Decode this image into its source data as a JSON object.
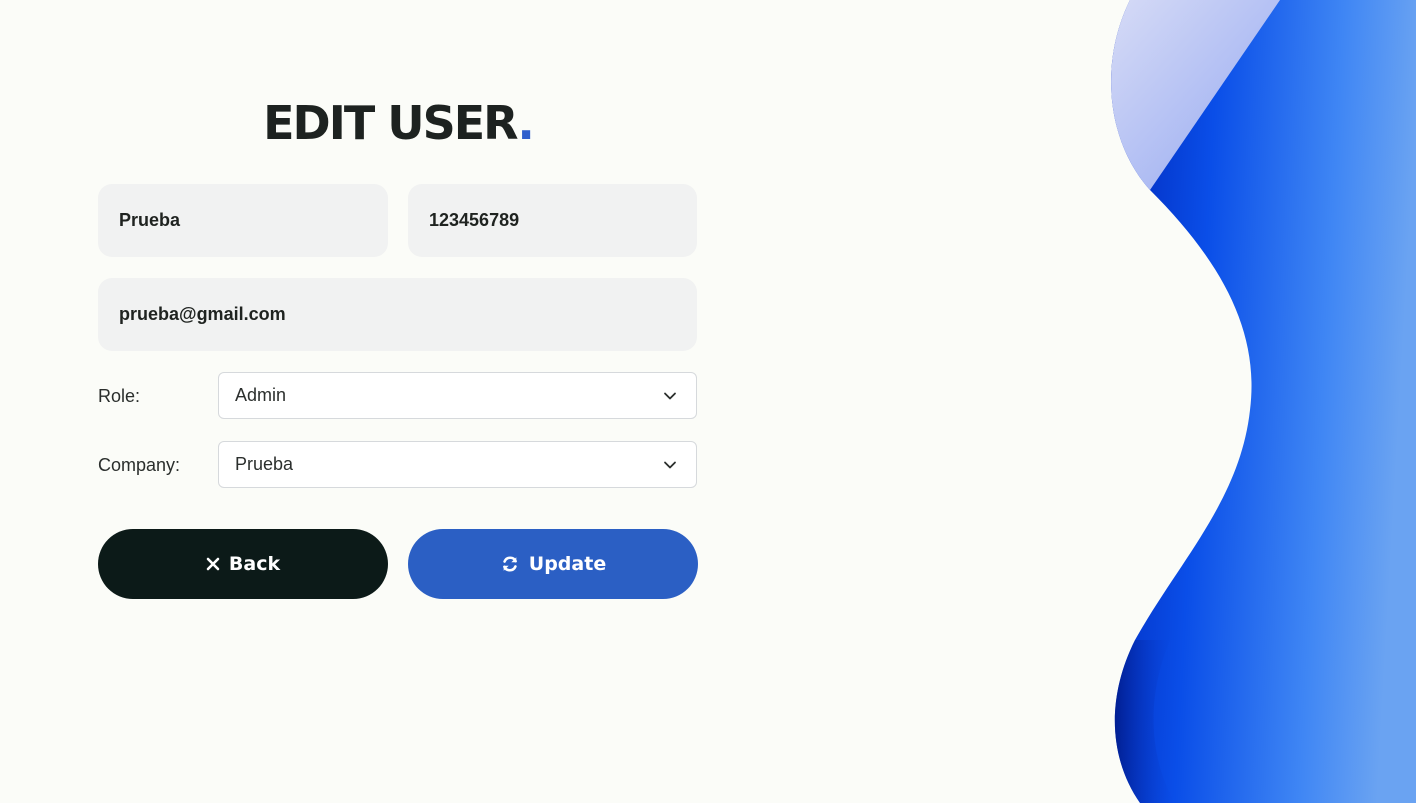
{
  "form": {
    "title": "EDIT USER",
    "title_dot": ".",
    "name_value": "Prueba",
    "phone_value": "123456789",
    "email_value": "prueba@gmail.com",
    "role_label": "Role:",
    "role_selected": "Admin",
    "company_label": "Company:",
    "company_selected": "Prueba"
  },
  "actions": {
    "back_label": "Back",
    "back_icon": "close-icon",
    "update_label": "Update",
    "update_icon": "refresh-icon"
  },
  "colors": {
    "accent": "#2b5fc4",
    "back_button": "#0c1a18",
    "background": "#fbfcf8",
    "field_bg": "#f1f2f2"
  }
}
